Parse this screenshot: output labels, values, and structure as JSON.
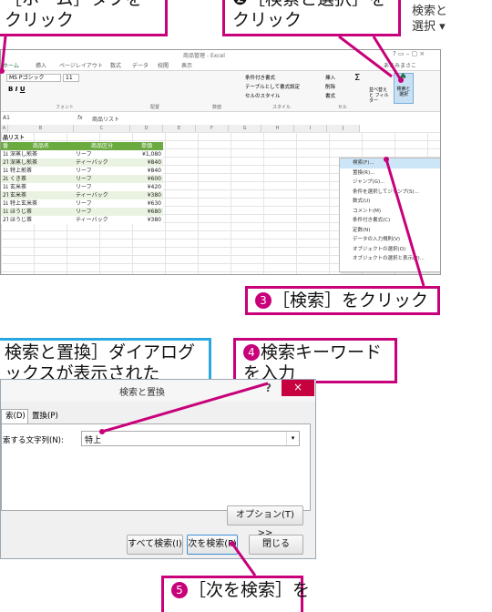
{
  "callouts": {
    "c1_line1": "［ホーム］タブを",
    "c1_line2": "クリック",
    "c2_line1": "❷［検索と選択］を",
    "c2_line2": "クリック",
    "c3_num": "❸",
    "c3_text": "［検索］をクリック",
    "c4_line1": "検索と置換］ダイアログ",
    "c4_line2": "ックスが表示された",
    "c5_num": "❹",
    "c5_line1": "検索キーワード",
    "c5_line2": "を入力",
    "c6_num": "❺",
    "c6_text": "［次を検索］を"
  },
  "top_right_button": {
    "line1": "検索と",
    "line2": "選択 ▾"
  },
  "excel": {
    "window_title": "商品管理 - Excel",
    "user": "あさみまさこ",
    "tabs": [
      "ホーム",
      "挿入",
      "ページレイアウト",
      "数式",
      "データ",
      "校閲",
      "表示"
    ],
    "font_name": "MS Pゴシック",
    "font_size": "11",
    "ribbon_groups": [
      "フォント",
      "配置",
      "数値",
      "スタイル",
      "セル"
    ],
    "conditional_format": "条件付き書式",
    "table_format": "テーブルとして書式設定",
    "cell_style": "セルのスタイル",
    "insert_btn": "挿入",
    "delete_btn": "削除",
    "format_btn": "書式",
    "sort_filter": "並べ替えと フィルター",
    "find_select": "検索と 選択",
    "name_box": "A1",
    "fx_label": "fx",
    "formula_value": "商品リスト",
    "columns": [
      "A",
      "B",
      "C",
      "D",
      "E",
      "F",
      "G",
      "H",
      "I",
      "J"
    ],
    "table_title": "品リスト",
    "table_headers": [
      "番号",
      "商品名",
      "商品区分",
      "単価"
    ],
    "rows": [
      [
        "1L",
        "深蒸し煎茶",
        "リーフ",
        "¥1,080"
      ],
      [
        "2T",
        "深蒸し煎茶",
        "ティーバック",
        "¥840"
      ],
      [
        "1L",
        "特上煎茶",
        "リーフ",
        "¥840"
      ],
      [
        "2L",
        "くき茶",
        "リーフ",
        "¥600"
      ],
      [
        "1L",
        "玄米茶",
        "リーフ",
        "¥420"
      ],
      [
        "2T",
        "玄米茶",
        "ティーバック",
        "¥380"
      ],
      [
        "1L",
        "特上玄米茶",
        "リーフ",
        "¥630"
      ],
      [
        "1L",
        "ほうじ茶",
        "リーフ",
        "¥680"
      ],
      [
        "2T",
        "ほうじ茶",
        "ティーバック",
        "¥380"
      ]
    ],
    "menu_items": [
      "検索(F)...",
      "置換(R)...",
      "ジャンプ(G)...",
      "条件を選択してジャンプ(S)...",
      "数式(U)",
      "コメント(M)",
      "条件付き書式(C)",
      "定数(N)",
      "データの入力規則(V)",
      "オブジェクトの選択(O)",
      "オブジェクトの選択と表示(P)..."
    ]
  },
  "dialog": {
    "title": "検索と置換",
    "help": "?",
    "close": "×",
    "tab_find": "索(D)",
    "tab_replace": "置換(P)",
    "search_label": "索する文字列(N):",
    "search_value": "特上",
    "options_btn": "オプション(T) >>",
    "find_all_btn": "すべて検索(I)",
    "find_next_btn": "次を検索(F)",
    "close_btn": "閉じる"
  }
}
